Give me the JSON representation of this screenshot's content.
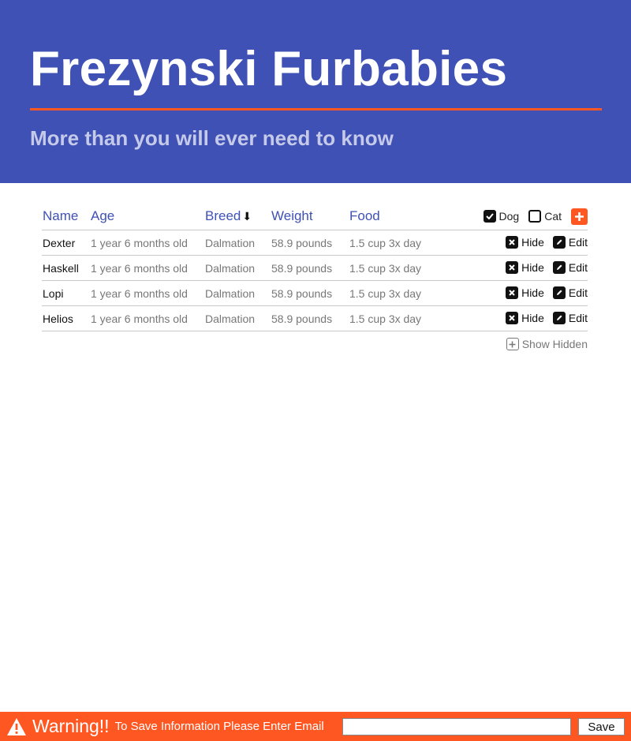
{
  "header": {
    "title": "Frezynski Furbabies",
    "subtitle": "More than you will ever need to know"
  },
  "table": {
    "columns": [
      {
        "label": "Name"
      },
      {
        "label": "Age"
      },
      {
        "label": "Breed",
        "sort_icon": "arrow-down-icon"
      },
      {
        "label": "Weight"
      },
      {
        "label": "Food"
      }
    ],
    "filters": [
      {
        "label": "Dog",
        "checked": true
      },
      {
        "label": "Cat",
        "checked": false
      }
    ],
    "add_icon": "plus-icon",
    "rows": [
      {
        "name": "Dexter",
        "age": "1 year 6 months old",
        "breed": "Dalmation",
        "weight": "58.9 pounds",
        "food": "1.5 cup 3x day"
      },
      {
        "name": "Haskell",
        "age": "1 year 6 months old",
        "breed": "Dalmation",
        "weight": "58.9 pounds",
        "food": "1.5 cup 3x day"
      },
      {
        "name": "Lopi",
        "age": "1 year 6 months old",
        "breed": "Dalmation",
        "weight": "58.9 pounds",
        "food": "1.5 cup 3x day"
      },
      {
        "name": "Helios",
        "age": "1 year 6 months old",
        "breed": "Dalmation",
        "weight": "58.9 pounds",
        "food": "1.5 cup 3x day"
      }
    ],
    "row_actions": {
      "hide_label": "Hide",
      "edit_label": "Edit"
    },
    "show_hidden_label": "Show Hidden"
  },
  "warning": {
    "title": "Warning!!",
    "message": "To Save Information Please Enter Email",
    "email_value": "",
    "save_label": "Save"
  },
  "colors": {
    "header_bg": "#3f51b5",
    "accent": "#ff5722",
    "subtitle": "#c5cae9",
    "link": "#3f51b5"
  }
}
